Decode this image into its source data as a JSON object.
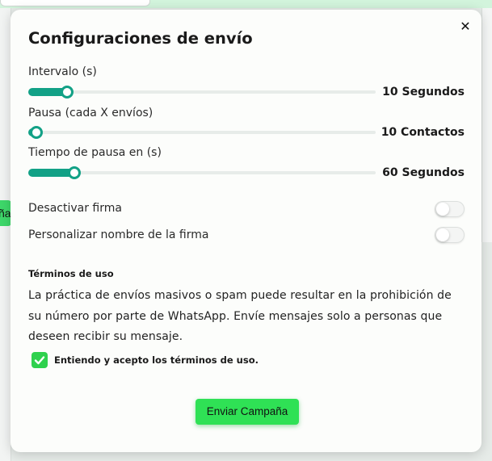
{
  "background": {
    "left_button_fragment": "ña"
  },
  "modal": {
    "title": "Configuraciones de envío",
    "close_label": "✕",
    "sliders": [
      {
        "label": "Intervalo (s)",
        "value_text": "10 Segundos",
        "level": 0.11
      },
      {
        "label": "Pausa (cada X envíos)",
        "value_text": "10 Contactos",
        "level": 0.02
      },
      {
        "label": "Tiempo de pausa en (s)",
        "value_text": "60 Segundos",
        "level": 0.13
      }
    ],
    "toggles": [
      {
        "label": "Desactivar firma",
        "on": false
      },
      {
        "label": "Personalizar nombre de la firma",
        "on": false
      }
    ],
    "terms": {
      "heading": "Términos de uso",
      "lines": [
        "La práctica de envíos masivos o spam puede resultar en la prohibición de",
        "su número por parte de WhatsApp. Envíe mensajes solo a personas que",
        "deseen recibir su mensaje."
      ],
      "accept_label": "Entiendo y acepto los términos de uso.",
      "accepted": true
    },
    "send_button_label": "Enviar Campaña"
  },
  "colors": {
    "slider_accent": "#12a186",
    "checkbox_green": "#2fd14e",
    "button_green": "#2fe155"
  }
}
